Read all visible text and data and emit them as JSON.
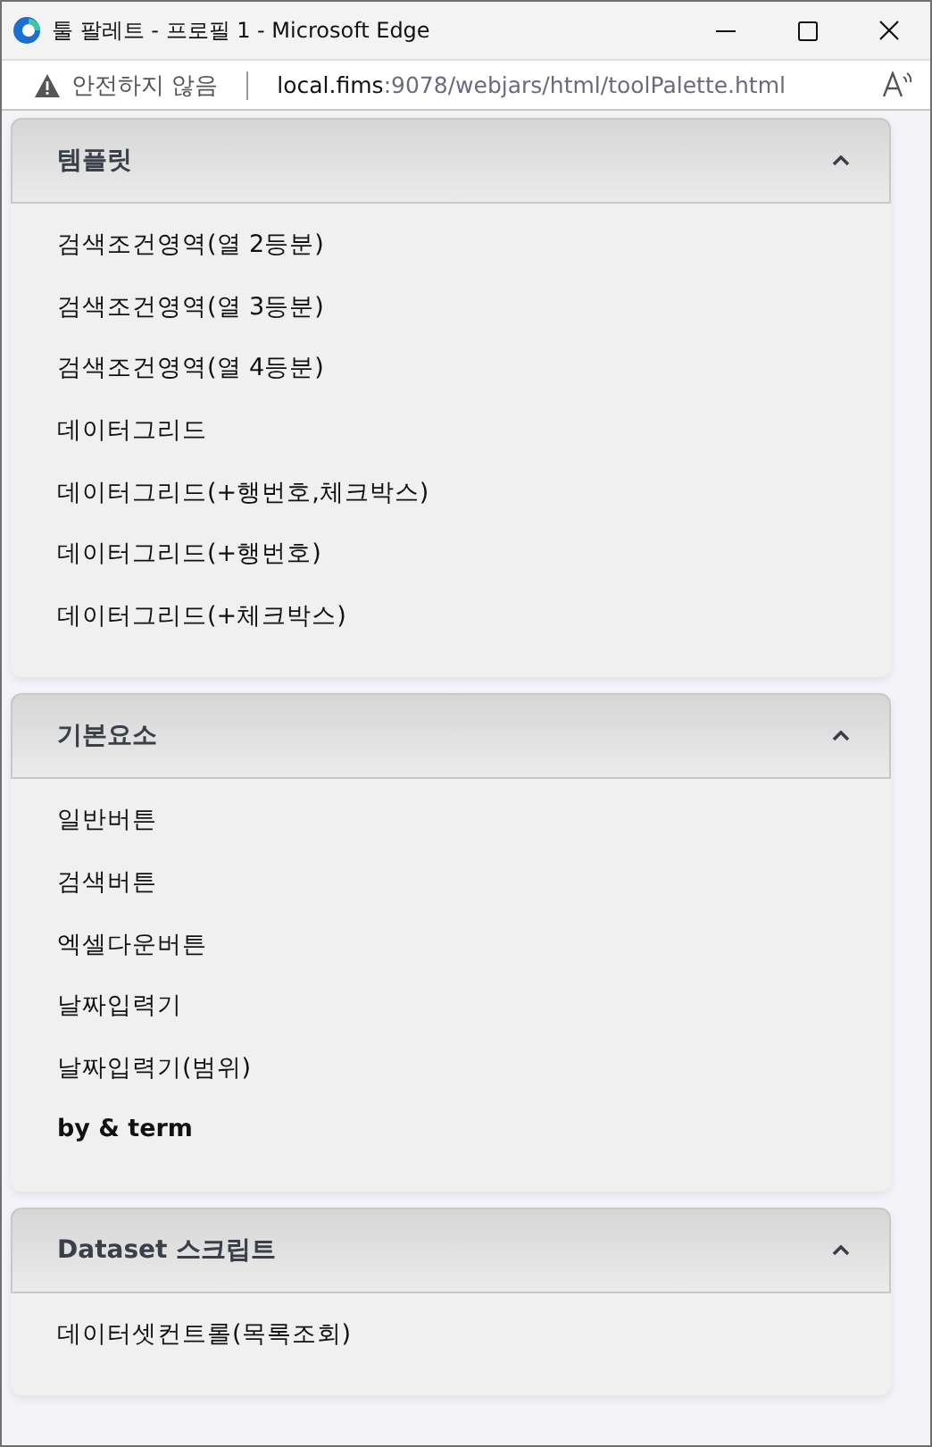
{
  "window": {
    "title": "툴 팔레트 - 프로필 1 - Microsoft Edge"
  },
  "address_bar": {
    "security": "안전하지 않음",
    "host": "local.fims",
    "path": ":9078/webjars/html/toolPalette.html"
  },
  "panels": [
    {
      "title": "템플릿",
      "expanded": true,
      "items": [
        {
          "label": "검색조건영역(열 2등분)",
          "bold": false
        },
        {
          "label": "검색조건영역(열 3등분)",
          "bold": false
        },
        {
          "label": "검색조건영역(열 4등분)",
          "bold": false
        },
        {
          "label": "데이터그리드",
          "bold": false
        },
        {
          "label": "데이터그리드(+행번호,체크박스)",
          "bold": false
        },
        {
          "label": "데이터그리드(+행번호)",
          "bold": false
        },
        {
          "label": "데이터그리드(+체크박스)",
          "bold": false
        }
      ]
    },
    {
      "title": "기본요소",
      "expanded": true,
      "items": [
        {
          "label": "일반버튼",
          "bold": false
        },
        {
          "label": "검색버튼",
          "bold": false
        },
        {
          "label": "엑셀다운버튼",
          "bold": false
        },
        {
          "label": "날짜입력기",
          "bold": false
        },
        {
          "label": "날짜입력기(범위)",
          "bold": false
        },
        {
          "label": "by & term",
          "bold": true
        }
      ]
    },
    {
      "title": "Dataset 스크립트",
      "expanded": true,
      "items": [
        {
          "label": "데이터셋컨트롤(목록조회)",
          "bold": false
        }
      ]
    }
  ]
}
